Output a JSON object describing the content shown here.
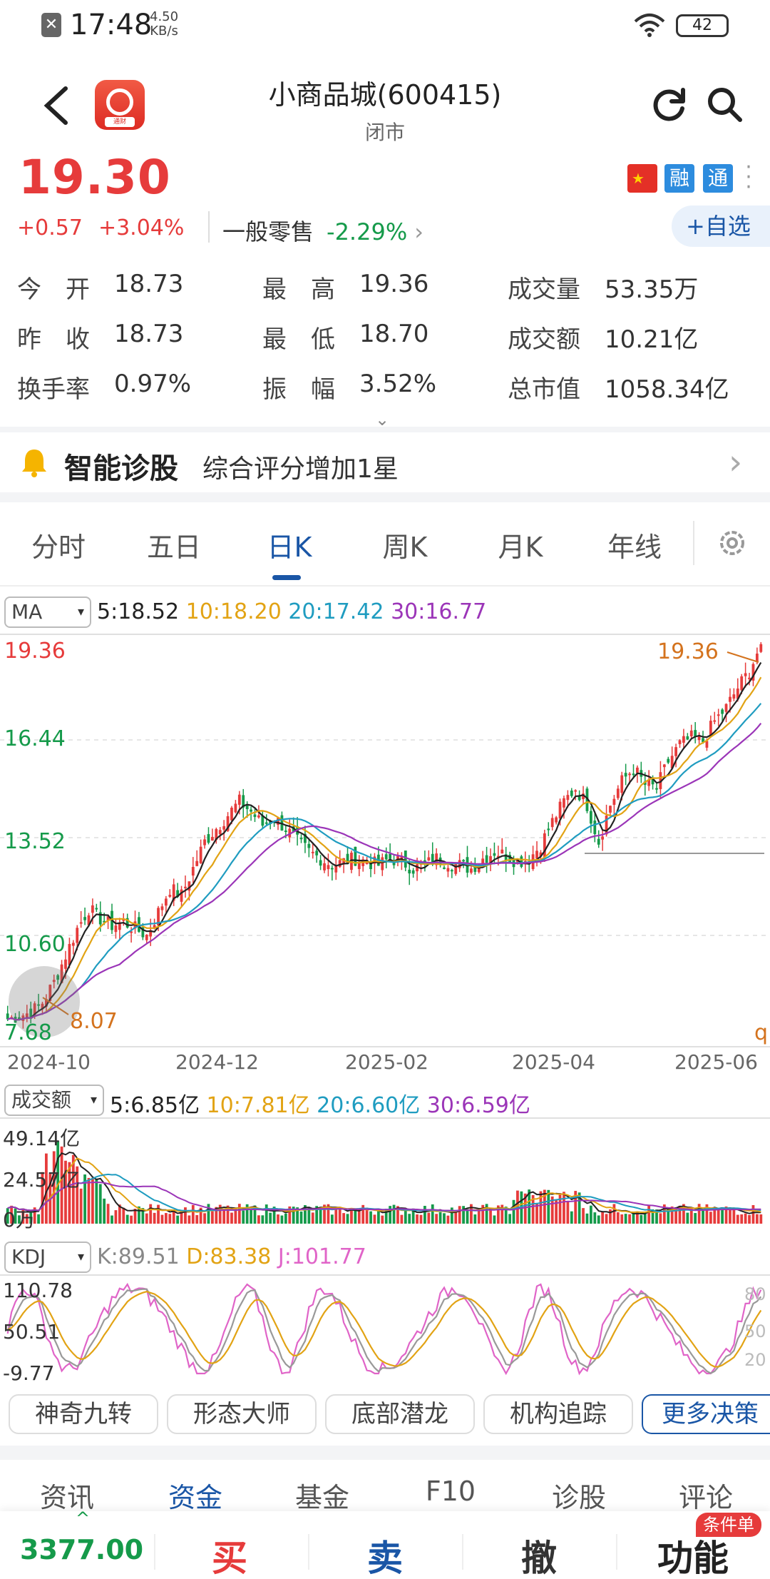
{
  "status_bar": {
    "time": "17:48",
    "speed_top": "4.50",
    "speed_bottom": "KB/s",
    "battery": "42"
  },
  "header": {
    "stock_name": "小商品城(600415)",
    "market_status": "闭市",
    "app_logo_label": "通财"
  },
  "price": {
    "last": "19.30",
    "change": "+0.57",
    "change_pct": "+3.04%",
    "sector_name": "一般零售",
    "sector_pct": "-2.29%",
    "sector_chevron": "›",
    "flag_text": "★",
    "badge_rong": "融",
    "badge_tong": "通",
    "add_watch": "+自选"
  },
  "quote": {
    "open_label": "今　开",
    "open": "18.73",
    "high_label": "最　高",
    "high": "19.36",
    "volume_label": "成交量",
    "volume": "53.35万",
    "prev_label": "昨　收",
    "prev": "18.73",
    "low_label": "最　低",
    "low": "18.70",
    "amount_label": "成交额",
    "amount": "10.21亿",
    "turnover_label": "换手率",
    "turnover": "0.97%",
    "amplitude_label": "振　幅",
    "amplitude": "3.52%",
    "mktcap_label": "总市值",
    "mktcap": "1058.34亿",
    "expand_chevron": "⌄"
  },
  "diagnosis": {
    "title": "智能诊股",
    "text": "综合评分增加1星",
    "chevron": "›"
  },
  "chart_tabs": [
    "分时",
    "五日",
    "日K",
    "周K",
    "月K",
    "年线"
  ],
  "indicators": {
    "ma_select": "MA",
    "ma5": "5:18.52",
    "ma10": "10:18.20",
    "ma20": "20:17.42",
    "ma30": "30:16.77",
    "vol_select": "成交额",
    "vol5": "5:6.85亿",
    "vol10": "10:7.81亿",
    "vol20": "20:6.60亿",
    "vol30": "30:6.59亿",
    "kdj_select": "KDJ",
    "k": "K:89.51",
    "d": "D:83.38",
    "j": "J:101.77",
    "select_arrow": "▾"
  },
  "chart_data": {
    "type": "candlestick",
    "price_axis": {
      "ticks": [
        "19.36",
        "16.44",
        "13.52",
        "10.60",
        "7.68"
      ],
      "ylim": [
        7.68,
        19.36
      ]
    },
    "x_ticks": [
      "2024-10",
      "2024-12",
      "2025-02",
      "2025-04",
      "2025-06"
    ],
    "annotations": {
      "high_marker": "19.36",
      "low_marker": "8.07",
      "edge_mark": "q"
    },
    "close_series": [
      8.1,
      8.2,
      8.3,
      8.6,
      9.2,
      10.0,
      10.8,
      11.4,
      11.1,
      10.9,
      11.0,
      10.8,
      10.6,
      11.3,
      12.0,
      11.8,
      12.6,
      13.4,
      13.8,
      14.2,
      14.6,
      14.3,
      13.9,
      14.1,
      13.8,
      13.4,
      13.1,
      12.9,
      12.7,
      12.8,
      12.9,
      12.8,
      12.7,
      12.9,
      12.8,
      12.6,
      12.7,
      12.9,
      12.8,
      12.7,
      12.6,
      12.9,
      13.1,
      13.0,
      12.8,
      12.9,
      13.3,
      14.0,
      14.6,
      15.0,
      14.5,
      13.4,
      14.5,
      15.2,
      15.6,
      15.1,
      15.0,
      15.8,
      16.3,
      16.5,
      16.4,
      17.0,
      17.4,
      18.0,
      18.5,
      19.3
    ],
    "ma_colors": {
      "ma5": "#222222",
      "ma10": "#e2a314",
      "ma20": "#1f9cc0",
      "ma30": "#9b35b8"
    },
    "volume_axis": {
      "ticks": [
        "49.14亿",
        "24.57亿",
        "0万"
      ]
    },
    "kdj_axis": {
      "ticks": [
        "110.78",
        "50.51",
        "-9.77"
      ],
      "right_ticks": [
        "80",
        "50",
        "20"
      ]
    }
  },
  "strategy_chips": [
    "神奇九转",
    "形态大师",
    "底部潜龙",
    "机构追踪",
    "更多决策"
  ],
  "info_tabs": [
    "资讯",
    "资金",
    "基金",
    "F10",
    "诊股",
    "评论"
  ],
  "bottom_bar": {
    "index_caret": "^",
    "index_value": "3377.00",
    "buy": "买",
    "sell": "卖",
    "cancel": "撤",
    "func": "功能",
    "cond_badge": "条件单"
  },
  "colors": {
    "up": "#e63b3b",
    "down": "#159a4a",
    "accent": "#1a56a6"
  }
}
